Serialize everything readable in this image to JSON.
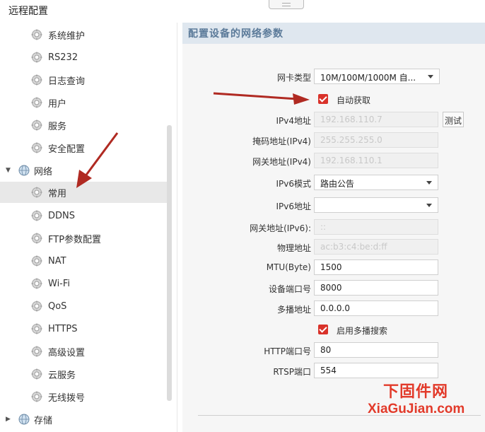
{
  "window": {
    "title": "远程配置"
  },
  "sidebar": {
    "items": [
      {
        "label": "系统维护"
      },
      {
        "label": "RS232"
      },
      {
        "label": "日志查询"
      },
      {
        "label": "用户"
      },
      {
        "label": "服务"
      },
      {
        "label": "安全配置"
      }
    ],
    "network_group": {
      "label": "网络"
    },
    "network_items": [
      {
        "label": "常用",
        "active": true
      },
      {
        "label": "DDNS"
      },
      {
        "label": "FTP参数配置"
      },
      {
        "label": "NAT"
      },
      {
        "label": "Wi-Fi"
      },
      {
        "label": "QoS"
      },
      {
        "label": "HTTPS"
      },
      {
        "label": "高级设置"
      },
      {
        "label": "云服务"
      },
      {
        "label": "无线拨号"
      }
    ],
    "storage_group": {
      "label": "存储"
    }
  },
  "content": {
    "header": "配置设备的网络参数",
    "nic_type": {
      "label": "网卡类型",
      "value": "10M/100M/1000M 自..."
    },
    "auto_obtain": {
      "label": "自动获取",
      "checked": true
    },
    "ipv4": {
      "label": "IPv4地址",
      "value": "192.168.110.7"
    },
    "test_button": "测试",
    "mask": {
      "label": "掩码地址(IPv4)",
      "value": "255.255.255.0"
    },
    "gateway4": {
      "label": "网关地址(IPv4)",
      "value": "192.168.110.1"
    },
    "ipv6_mode": {
      "label": "IPv6模式",
      "value": "路由公告"
    },
    "ipv6_addr": {
      "label": "IPv6地址",
      "value": ""
    },
    "gateway6": {
      "label": "网关地址(IPv6):",
      "value": "::"
    },
    "mac": {
      "label": "物理地址",
      "value": "ac:b3:c4:be:d:ff"
    },
    "mtu": {
      "label": "MTU(Byte)",
      "value": "1500"
    },
    "device_port": {
      "label": "设备端口号",
      "value": "8000"
    },
    "multicast": {
      "label": "多播地址",
      "value": "0.0.0.0"
    },
    "multicast_search": {
      "label": "启用多播搜索",
      "checked": true
    },
    "http_port": {
      "label": "HTTP端口号",
      "value": "80"
    },
    "rtsp_port": {
      "label": "RTSP端口",
      "value": "554"
    }
  },
  "watermark": {
    "line1": "下固件网",
    "line2": "XiaGuJian.com"
  },
  "colors": {
    "checkbox": "#d9322a",
    "arrow": "#b02a22",
    "header_bg": "#dfe7ef",
    "header_text": "#5b7a99",
    "active_bg": "#e8e8e8",
    "watermark": "#e23a2a"
  },
  "icons": {
    "sidebar_item": "gear-icon",
    "group": "globe-icon",
    "dropdown": "chevron-down-icon"
  }
}
